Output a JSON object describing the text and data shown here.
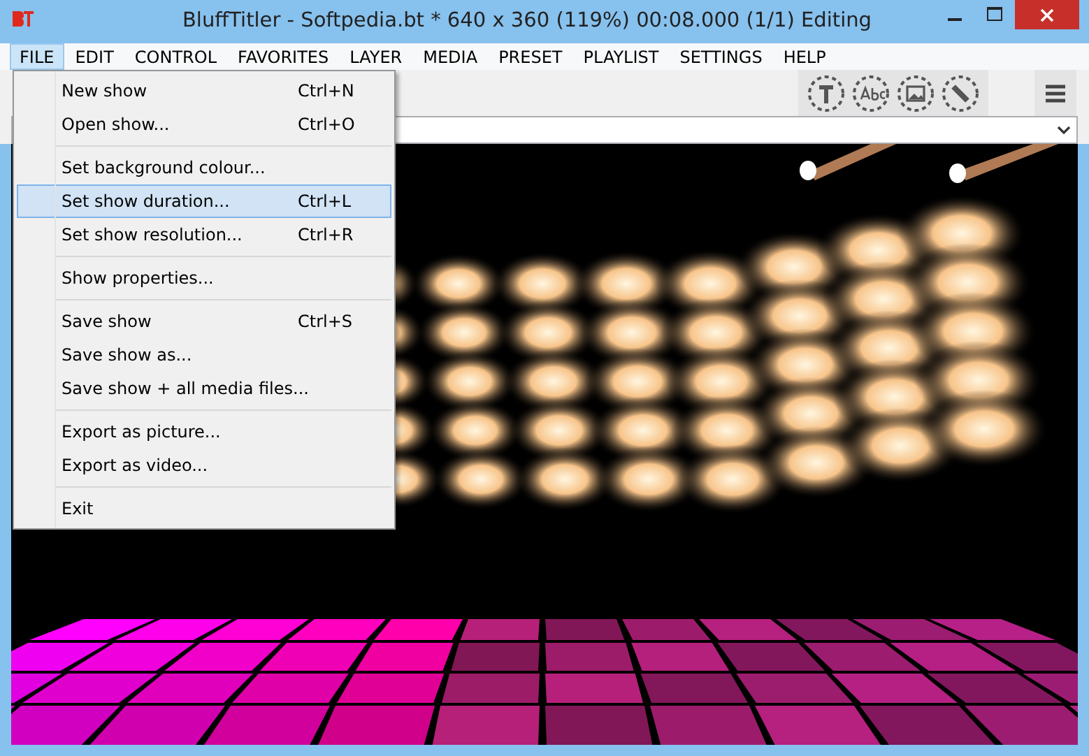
{
  "window": {
    "title": "BluffTitler - Softpedia.bt * 640 x 360 (119%) 00:08.000 (1/1) Editing"
  },
  "menu_bar": [
    {
      "label": "FILE",
      "selected": true
    },
    {
      "label": "EDIT",
      "selected": false
    },
    {
      "label": "CONTROL",
      "selected": false
    },
    {
      "label": "FAVORITES",
      "selected": false
    },
    {
      "label": "LAYER",
      "selected": false
    },
    {
      "label": "MEDIA",
      "selected": false
    },
    {
      "label": "PRESET",
      "selected": false
    },
    {
      "label": "PLAYLIST",
      "selected": false
    },
    {
      "label": "SETTINGS",
      "selected": false
    },
    {
      "label": "HELP",
      "selected": false
    }
  ],
  "file_menu": [
    {
      "kind": "item",
      "label": "New show",
      "shortcut": "Ctrl+N",
      "selected": false
    },
    {
      "kind": "item",
      "label": "Open show...",
      "shortcut": "Ctrl+O",
      "selected": false
    },
    {
      "kind": "separator"
    },
    {
      "kind": "item",
      "label": "Set background colour...",
      "selected": false
    },
    {
      "kind": "item",
      "label": "Set show duration...",
      "shortcut": "Ctrl+L",
      "selected": true
    },
    {
      "kind": "item",
      "label": "Set show resolution...",
      "shortcut": "Ctrl+R",
      "selected": false
    },
    {
      "kind": "separator"
    },
    {
      "kind": "item",
      "label": "Show properties...",
      "selected": false
    },
    {
      "kind": "separator"
    },
    {
      "kind": "item",
      "label": "Save show",
      "shortcut": "Ctrl+S",
      "selected": false
    },
    {
      "kind": "item",
      "label": "Save show as...",
      "selected": false
    },
    {
      "kind": "item",
      "label": "Save show + all media files...",
      "selected": false
    },
    {
      "kind": "separator"
    },
    {
      "kind": "item",
      "label": "Export as picture...",
      "selected": false
    },
    {
      "kind": "item",
      "label": "Export as video...",
      "selected": false
    },
    {
      "kind": "separator"
    },
    {
      "kind": "item",
      "label": "Exit",
      "selected": false
    }
  ]
}
